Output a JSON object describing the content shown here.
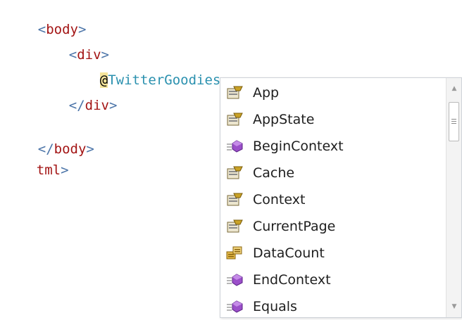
{
  "code": {
    "line1": {
      "open": "<",
      "tag": "body",
      "close": ">"
    },
    "line2": {
      "open": "<",
      "tag": "div",
      "close": ">"
    },
    "line3": {
      "at": "@",
      "object": "TwitterGoodies",
      "dot": "."
    },
    "line4": {
      "open": "</",
      "tag": "div",
      "close": ">"
    },
    "line6": {
      "open": "</",
      "tag": "body",
      "close": ">"
    },
    "line7": {
      "tag": "tml",
      "close": ">"
    }
  },
  "intellisense": {
    "items": [
      {
        "label": "App",
        "icon": "property-icon"
      },
      {
        "label": "AppState",
        "icon": "property-icon"
      },
      {
        "label": "BeginContext",
        "icon": "method-icon"
      },
      {
        "label": "Cache",
        "icon": "property-icon"
      },
      {
        "label": "Context",
        "icon": "property-icon"
      },
      {
        "label": "CurrentPage",
        "icon": "property-icon"
      },
      {
        "label": "DataCount",
        "icon": "field-icon"
      },
      {
        "label": "EndContext",
        "icon": "method-icon"
      },
      {
        "label": "Equals",
        "icon": "method-icon"
      }
    ],
    "scroll_up": "▲",
    "scroll_down": "▼"
  }
}
